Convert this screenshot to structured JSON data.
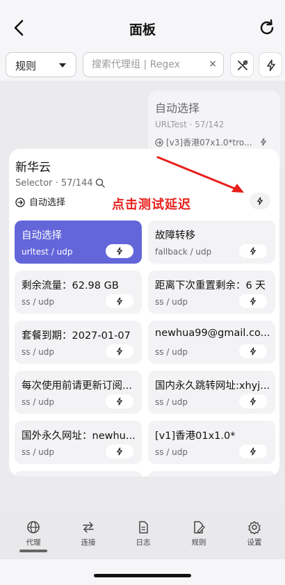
{
  "header": {
    "title": "面板",
    "back_icon": "chevron-left-icon",
    "refresh_icon": "refresh-icon"
  },
  "filters": {
    "mode_value": "规则",
    "search_placeholder": "搜索代理组 | Regex",
    "clear_glyph": "×",
    "tool_icon": "wrench-icon",
    "speed_icon": "bolt-icon"
  },
  "background_group": {
    "name": "自动选择",
    "subtitle": "URLTest · 57/142",
    "current": "[v3]香港07x1.0*tro..."
  },
  "group": {
    "name": "新华云",
    "type": "Selector",
    "count": "57/144",
    "meta_sep": " · ",
    "current": "自动选择",
    "annotation": "点击测试延迟",
    "annotation_color": "#e8201c"
  },
  "proxies": [
    {
      "name": "自动选择",
      "type": "urltest / udp",
      "selected": true
    },
    {
      "name": "故障转移",
      "type": "fallback / udp",
      "selected": false
    },
    {
      "name": "剩余流量：62.98 GB",
      "type": "ss / udp",
      "selected": false
    },
    {
      "name": "距离下次重置剩余：6 天",
      "type": "ss / udp",
      "selected": false
    },
    {
      "name": "套餐到期：2027-01-07",
      "type": "ss / udp",
      "selected": false
    },
    {
      "name": "newhua99@gmail.co...",
      "type": "ss / udp",
      "selected": false
    },
    {
      "name": "每次使用前请更新订阅...",
      "type": "ss / udp",
      "selected": false
    },
    {
      "name": "国内永久跳转网址:xhyj...",
      "type": "ss / udp",
      "selected": false
    },
    {
      "name": "国外永久网址：newhu...",
      "type": "ss / udp",
      "selected": false
    },
    {
      "name": "[v1]香港01x1.0*",
      "type": "ss / udp",
      "selected": false
    }
  ],
  "nav": {
    "tabs": [
      {
        "label": "代理",
        "icon": "globe-icon",
        "active": true
      },
      {
        "label": "连接",
        "icon": "arrows-swap-icon",
        "active": false
      },
      {
        "label": "日志",
        "icon": "document-icon",
        "active": false
      },
      {
        "label": "规则",
        "icon": "rules-icon",
        "active": false
      },
      {
        "label": "设置",
        "icon": "gear-icon",
        "active": false
      }
    ]
  },
  "colors": {
    "accent": "#6366d9",
    "annotation": "#e8201c"
  }
}
